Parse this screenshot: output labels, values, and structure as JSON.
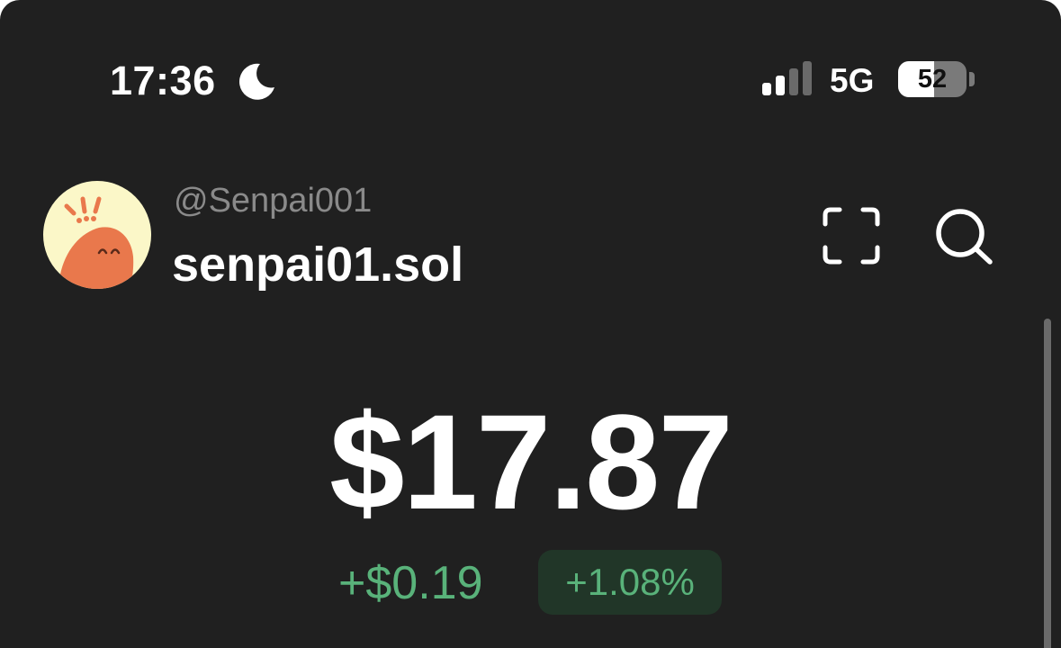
{
  "status_bar": {
    "time": "17:36",
    "focus_icon": "moon-icon",
    "signal_bars_active": 2,
    "signal_bars_total": 4,
    "network": "5G",
    "battery_percent": 52,
    "battery_label": "52"
  },
  "account": {
    "handle": "@Senpai001",
    "name": "senpai01.sol",
    "avatar_icon": "senpai-avatar-icon"
  },
  "header_actions": {
    "scan_icon": "scan-icon",
    "search_icon": "search-icon"
  },
  "balance": {
    "amount": "$17.87",
    "change_amount": "+$0.19",
    "change_percent": "+1.08%"
  },
  "colors": {
    "background": "#202020",
    "positive": "#59b27a",
    "positive_badge_bg": "#213628",
    "avatar_bg": "#fbf7c8",
    "avatar_blob": "#e9784c"
  }
}
